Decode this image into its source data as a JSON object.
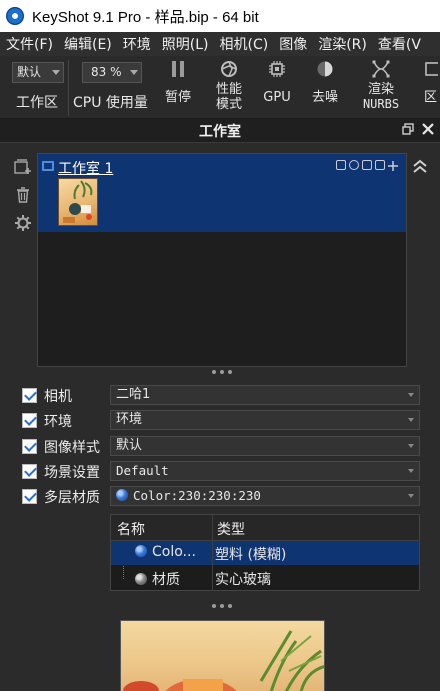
{
  "window": {
    "title": "KeyShot 9.1 Pro  - 样品.bip  - 64 bit"
  },
  "menu": [
    "文件(F)",
    "编辑(E)",
    "环境",
    "照明(L)",
    "相机(C)",
    "图像",
    "渲染(R)",
    "查看(V"
  ],
  "toolbar": {
    "workspace_value": "默认",
    "workspace_label": "工作区",
    "cpu_value": "83 %",
    "cpu_label": "CPU 使用量",
    "pause_label": "暂停",
    "perf_label_1": "性能",
    "perf_label_2": "模式",
    "gpu_label": "GPU",
    "denoise_label": "去噪",
    "nurbs_label_1": "渲染",
    "nurbs_label_2": "NURBS",
    "cutoff_label": "区"
  },
  "panel": {
    "title": "工作室"
  },
  "studios": [
    {
      "name": "工作室 1"
    }
  ],
  "properties": {
    "camera": {
      "label": "相机",
      "value": "二哈1"
    },
    "environment": {
      "label": "环境",
      "value": "环境"
    },
    "image_style": {
      "label": "图像样式",
      "value": "默认"
    },
    "scene_set": {
      "label": "场景设置",
      "value": "Default"
    },
    "multi_material": {
      "label": "多层材质",
      "value": "Color:230:230:230"
    }
  },
  "materials_table": {
    "columns": [
      "名称",
      "类型"
    ],
    "rows": [
      {
        "name": "Colo...",
        "type": "塑料 (模糊)",
        "icon": "blue-sphere-icon",
        "selected": true
      },
      {
        "name": "材质",
        "type": "实心玻璃",
        "icon": "gray-sphere-icon",
        "selected": false
      }
    ]
  },
  "colors": {
    "selection": "#0f3472",
    "accent": "#2a6ed0",
    "background": "#2b2b2b"
  }
}
